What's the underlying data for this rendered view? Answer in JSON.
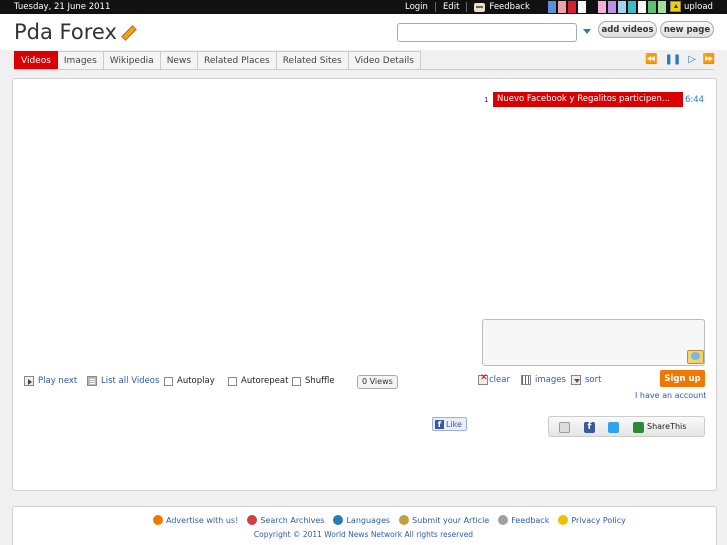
{
  "topbar": {
    "date": "Tuesday, 21 June 2011",
    "login": "Login",
    "edit": "Edit",
    "feedback": "Feedback",
    "upload": "upload",
    "swatches": [
      "#5b8fd8",
      "#f0a0a8",
      "#d82030",
      "#f8f8f8",
      "#111111",
      "#f4b0d8",
      "#c090e8",
      "#a8d0f0",
      "#40b8c8",
      "#f8f8f8",
      "#60c070",
      "#a0e0a0"
    ]
  },
  "header": {
    "title": "Pda Forex",
    "search_value": "",
    "add_videos": "add videos",
    "new_page": "new page"
  },
  "tabs": [
    {
      "label": "Videos",
      "active": true
    },
    {
      "label": "Images",
      "active": false
    },
    {
      "label": "Wikipedia",
      "active": false
    },
    {
      "label": "News",
      "active": false
    },
    {
      "label": "Related Places",
      "active": false
    },
    {
      "label": "Related Sites",
      "active": false
    },
    {
      "label": "Video Details",
      "active": false
    }
  ],
  "nav_icons": [
    "rewind-icon",
    "pause-icon",
    "play-icon",
    "fast-forward-icon"
  ],
  "playlist": [
    {
      "num": "1",
      "title": "Nuevo Facebook y Regalitos participen...",
      "duration": "6:44"
    }
  ],
  "controls": {
    "play_next": "Play next",
    "list_all": "List all Videos",
    "autoplay": "Autoplay",
    "autorepeat": "Autorepeat",
    "shuffle": "Shuffle",
    "views": "0 Views",
    "clear": "clear",
    "images": "images",
    "sort": "sort",
    "signup": "Sign up",
    "account": "I have an account, lo"
  },
  "social": {
    "like": "Like",
    "sharethis": "ShareThis"
  },
  "footer": {
    "links": [
      {
        "label": "Advertise with us!",
        "icon": "megaphone-icon",
        "color": "#f07800"
      },
      {
        "label": "Search Archives",
        "icon": "calendar-icon",
        "color": "#d04040"
      },
      {
        "label": "Languages",
        "icon": "globe-icon",
        "color": "#2a7ab8"
      },
      {
        "label": "Submit your Article",
        "icon": "quill-icon",
        "color": "#c0a040"
      },
      {
        "label": "Feedback",
        "icon": "feedback-icon",
        "color": "#a0a0a0"
      },
      {
        "label": "Privacy Policy",
        "icon": "lock-icon",
        "color": "#f0c000"
      }
    ],
    "copyright": "Copyright © 2011 World News Network All rights reserved"
  }
}
